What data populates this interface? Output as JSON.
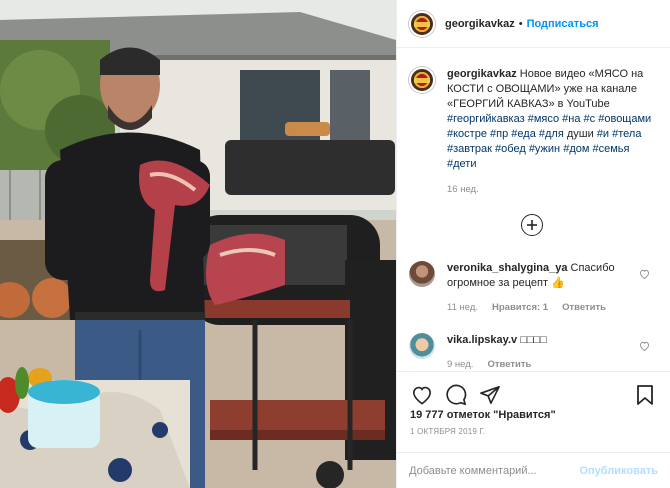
{
  "post": {
    "username": "georgikavkaz",
    "follow_label": "Подписаться",
    "dot": "•",
    "caption_user": "georgikavkaz",
    "caption_parts": [
      "Новое видео «МЯСО на КОСТИ с ОВОЩАМИ» уже на канале «ГЕОРГИЙ КАВКАЗ» в YouTube "
    ],
    "hashtags": [
      "#георгийкавказ",
      "#мясо",
      "#на",
      "#с",
      "#овощами",
      "#костре",
      "#пр",
      "#еда",
      "#для",
      "души",
      "#и",
      "#тела",
      "#завтрак",
      "#обед",
      "#ужин",
      "#дом",
      "#семья",
      "#дети"
    ],
    "caption_time": "16 нед.",
    "load_more": "⊕",
    "comments": [
      {
        "user": "veronika_shalygina_ya",
        "text": "Спасибо огромное за рецепт 👍",
        "time": "11 нед.",
        "likes": "Нравится: 1",
        "reply": "Ответить"
      },
      {
        "user": "vika.lipskay.v",
        "text": "□□□□",
        "time": "9 нед.",
        "reply": "Ответить"
      }
    ],
    "likes_text": "19 777 отметок \"Нравится\"",
    "date": "1 ОКТЯБРЯ 2019 Г.",
    "comment_placeholder": "Добавьте комментарий...",
    "publish_label": "Опубликовать"
  },
  "icons": {
    "like": "heart-icon",
    "comment": "comment-icon",
    "share": "share-icon",
    "save": "bookmark-icon",
    "comment_like": "heart-outline-icon"
  },
  "colors": {
    "accent": "#0095f6",
    "hashtag": "#00376b",
    "muted": "#8e8e8e",
    "publish_disabled": "#b2dffc"
  }
}
